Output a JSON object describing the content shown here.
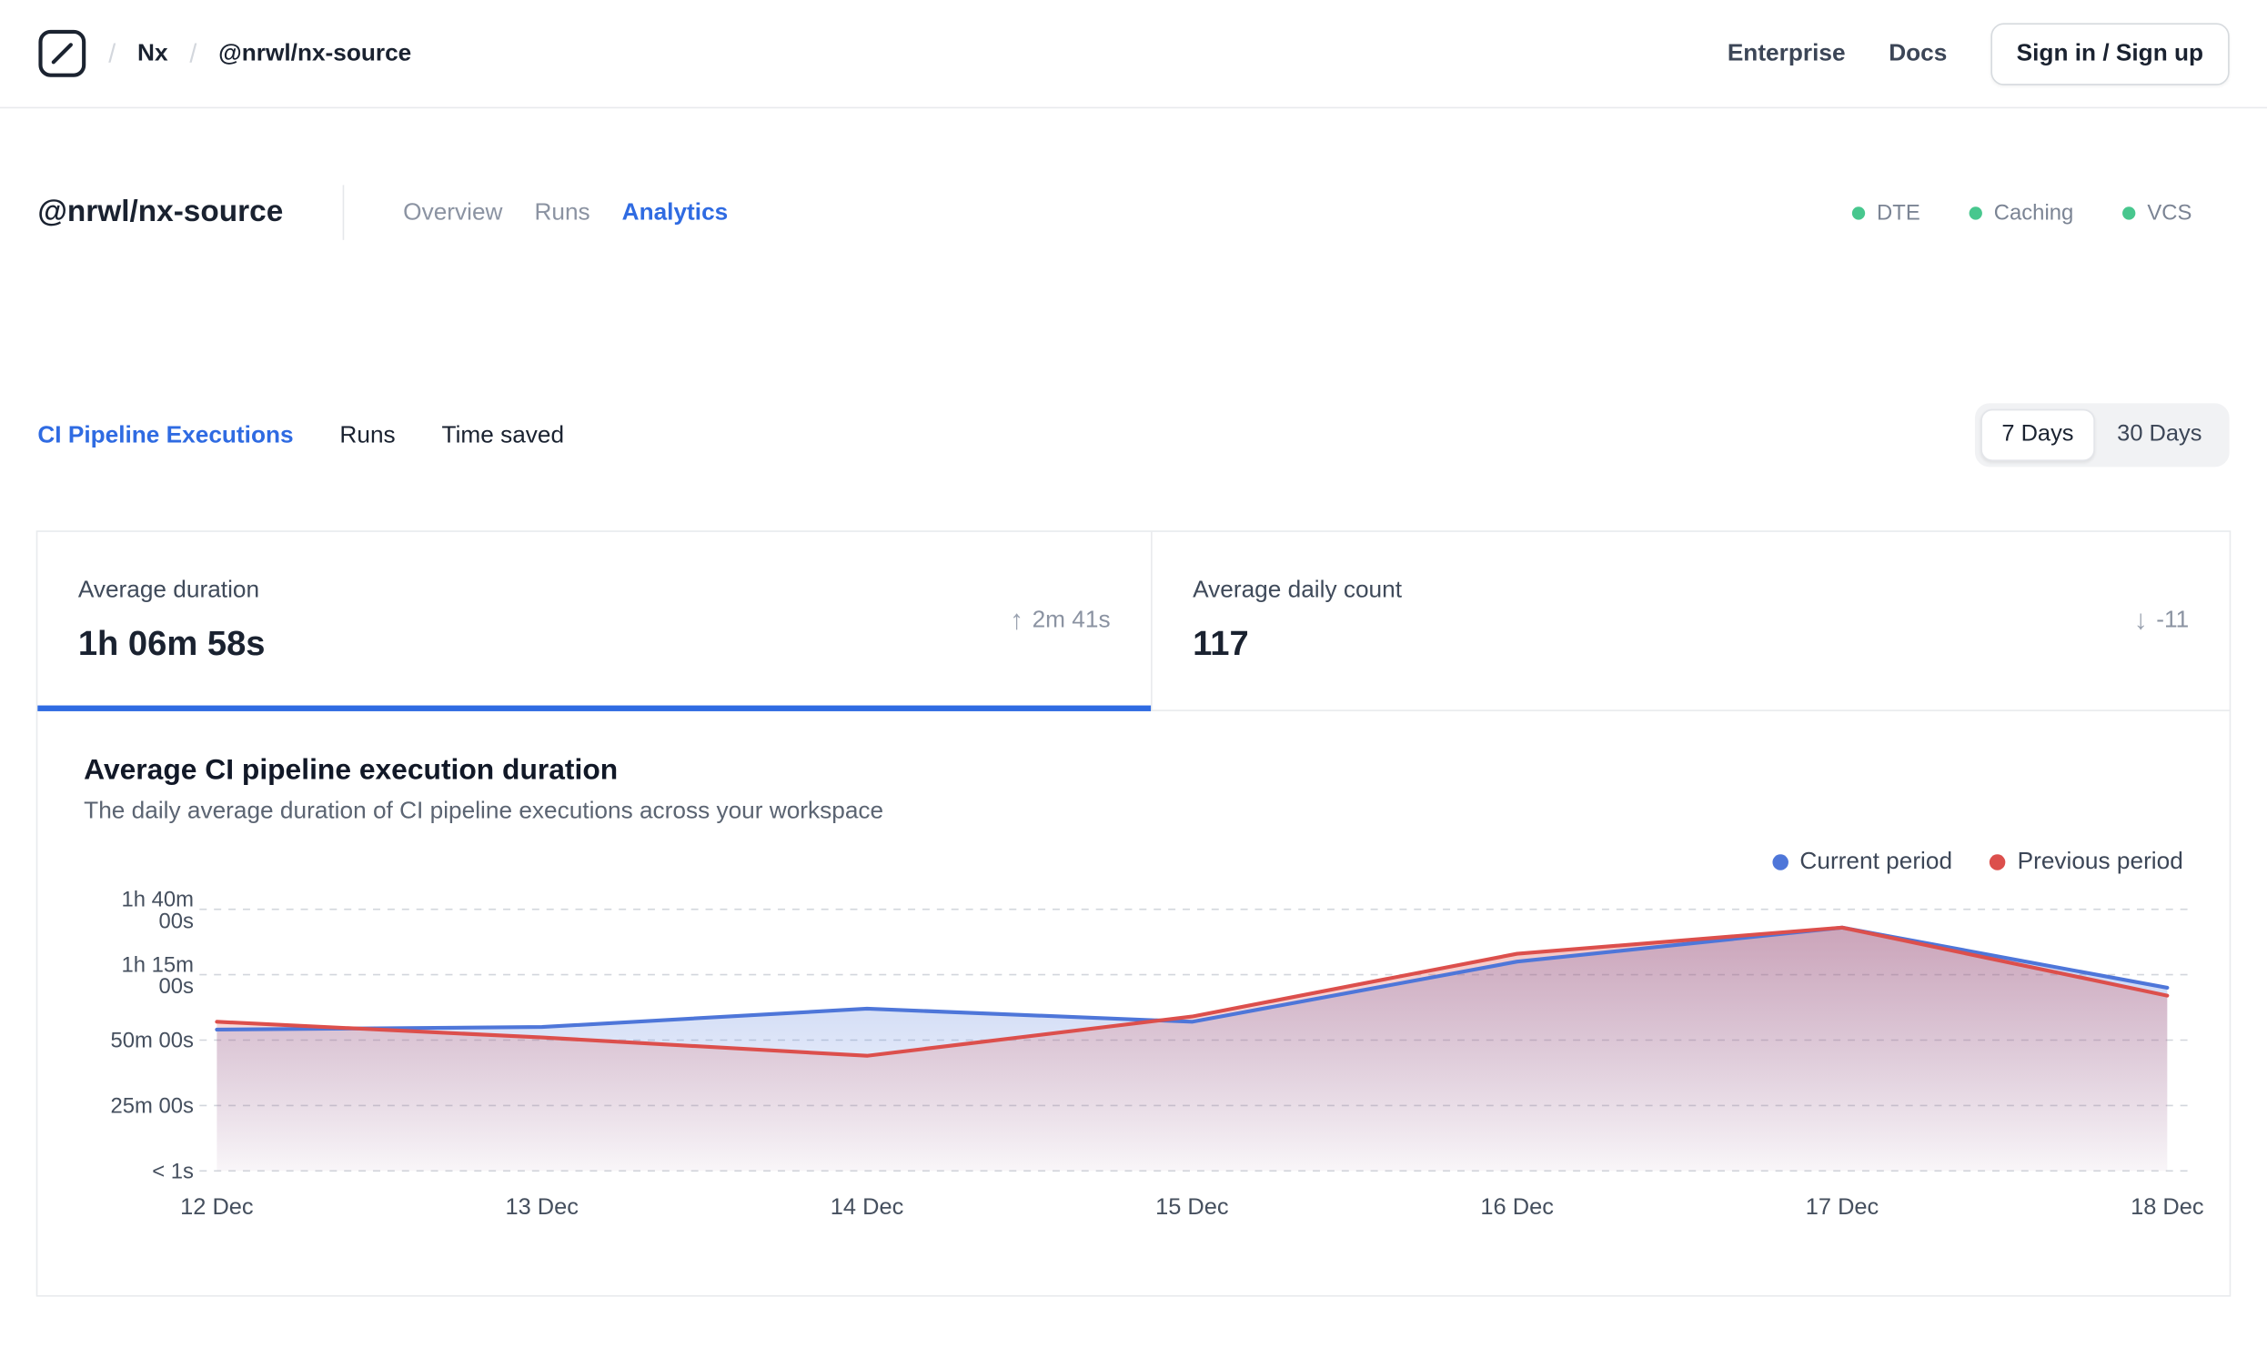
{
  "theme": {
    "accent": "#2f6be2",
    "status_green": "#48c78e"
  },
  "topbar": {
    "separator": "/",
    "org": "Nx",
    "repo": "@nrwl/nx-source",
    "links": [
      {
        "label": "Enterprise"
      },
      {
        "label": "Docs"
      }
    ],
    "signin_label": "Sign in / Sign up"
  },
  "header": {
    "title": "@nrwl/nx-source",
    "tabs": [
      {
        "label": "Overview",
        "active": false
      },
      {
        "label": "Runs",
        "active": false
      },
      {
        "label": "Analytics",
        "active": true
      }
    ],
    "statuses": [
      {
        "label": "DTE"
      },
      {
        "label": "Caching"
      },
      {
        "label": "VCS"
      }
    ]
  },
  "metric_tabs": [
    {
      "label": "CI Pipeline Executions",
      "active": true
    },
    {
      "label": "Runs",
      "active": false
    },
    {
      "label": "Time saved",
      "active": false
    }
  ],
  "range_toggle": {
    "options": [
      {
        "label": "7 Days",
        "active": true
      },
      {
        "label": "30 Days",
        "active": false
      }
    ]
  },
  "stat_cards": [
    {
      "title": "Average duration",
      "value": "1h 06m 58s",
      "arrow": "↑",
      "delta": "2m 41s",
      "delta_direction": "up",
      "active": true
    },
    {
      "title": "Average daily count",
      "value": "117",
      "arrow": "↓",
      "delta": "-11",
      "delta_direction": "down",
      "active": false
    }
  ],
  "chart_data": {
    "type": "area",
    "title": "Average CI pipeline execution duration",
    "subtitle": "The daily average duration of CI pipeline executions across your workspace",
    "categories": [
      "12 Dec",
      "13 Dec",
      "14 Dec",
      "15 Dec",
      "16 Dec",
      "17 Dec",
      "18 Dec"
    ],
    "series": [
      {
        "name": "Current period",
        "color": "#4e76d9",
        "values_minutes": [
          54,
          55,
          62,
          57,
          80,
          93,
          70
        ]
      },
      {
        "name": "Previous period",
        "color": "#dc4f4c",
        "values_minutes": [
          57,
          51,
          44,
          59,
          83,
          93,
          67
        ]
      }
    ],
    "y_ticks": [
      "1h 40m 00s",
      "1h 15m 00s",
      "50m 00s",
      "25m 00s",
      "< 1s"
    ],
    "y_range_minutes": [
      0,
      100
    ],
    "grid": "dashed-horizontal",
    "legend_position": "top-right"
  }
}
